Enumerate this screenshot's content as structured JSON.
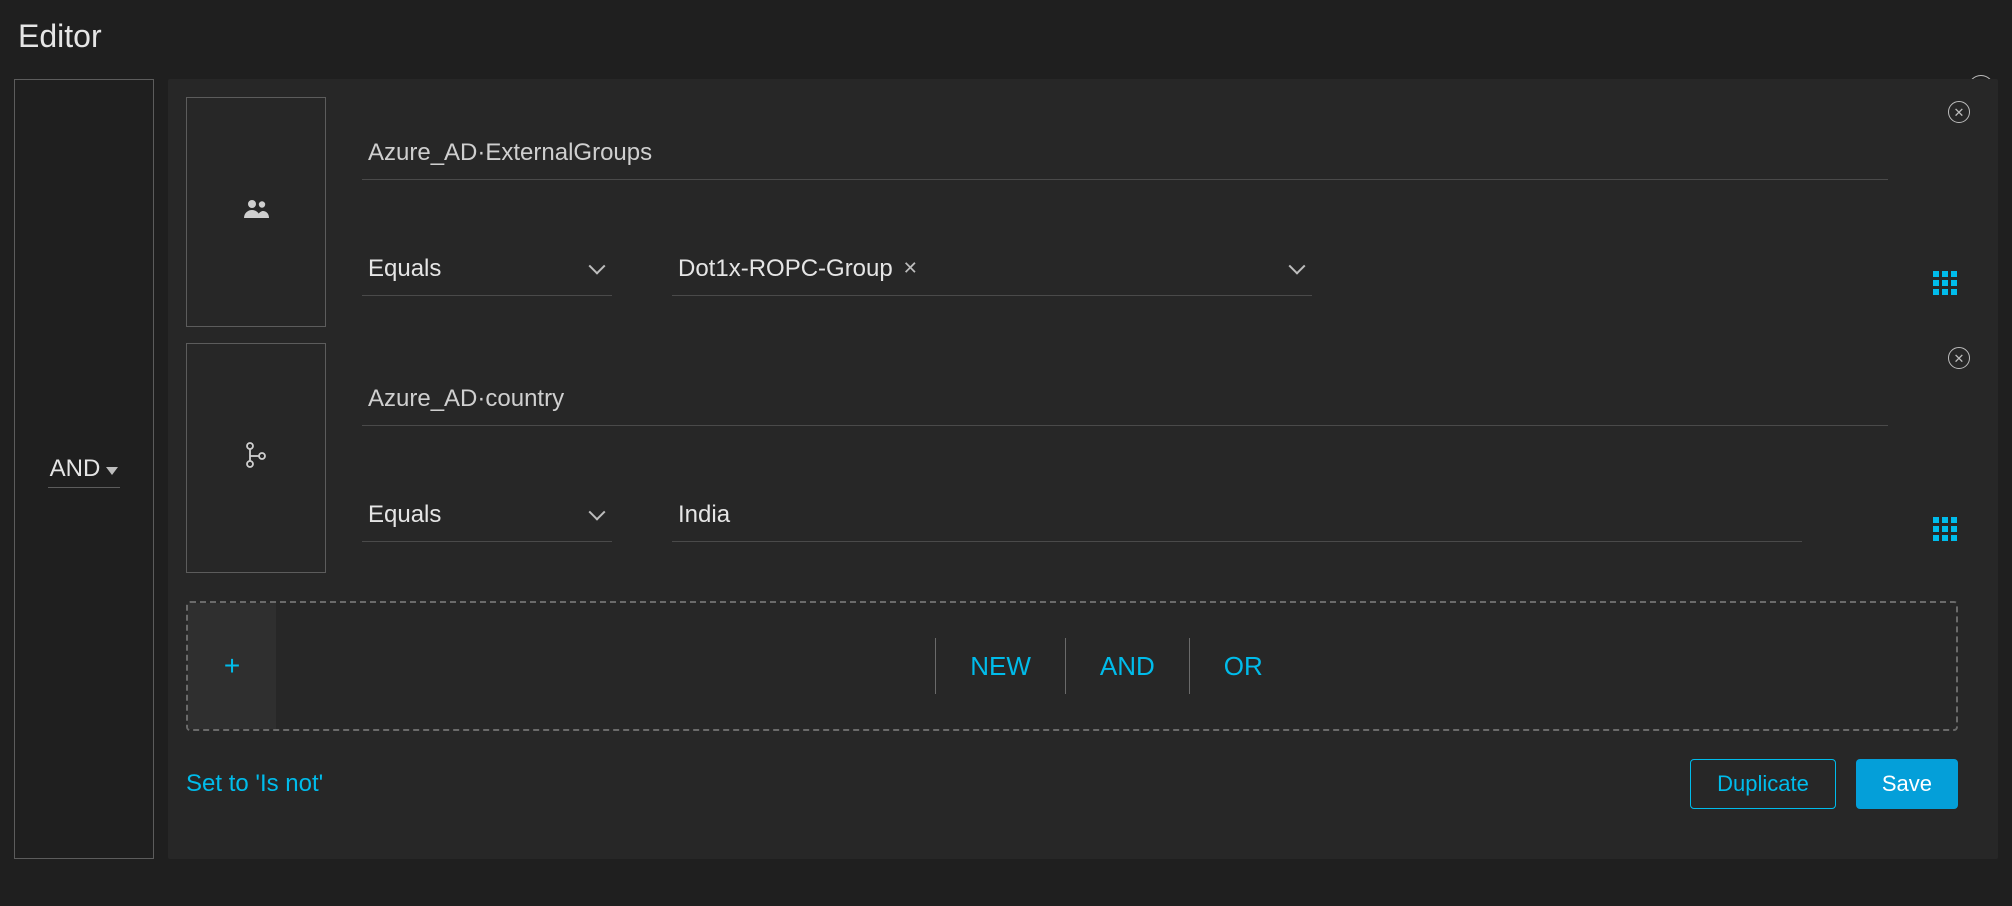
{
  "title": "Editor",
  "group": {
    "operator": "AND"
  },
  "rules": [
    {
      "icon": "users-icon",
      "attribute": "Azure_AD·ExternalGroups",
      "operator": "Equals",
      "value_type": "chip_select",
      "value": "Dot1x-ROPC-Group"
    },
    {
      "icon": "hierarchy-icon",
      "attribute": "Azure_AD·country",
      "operator": "Equals",
      "value_type": "text",
      "value": "India"
    }
  ],
  "add_row": {
    "plus": "+",
    "options": {
      "new": "NEW",
      "and": "AND",
      "or": "OR"
    }
  },
  "footer": {
    "set_not": "Set to 'Is not'",
    "duplicate": "Duplicate",
    "save": "Save"
  }
}
